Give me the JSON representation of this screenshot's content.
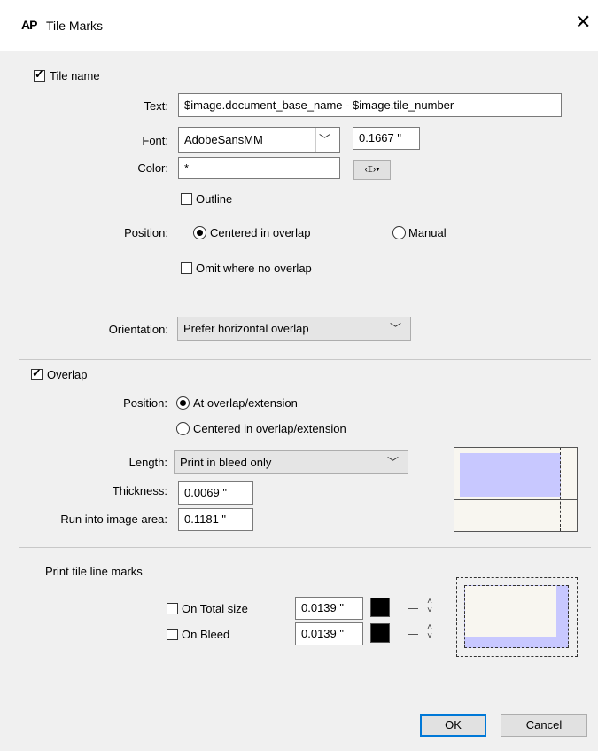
{
  "window": {
    "app_icon": "AP",
    "title": "Tile Marks",
    "close_glyph": "✕"
  },
  "tile_name": {
    "checkbox_label": "Tile name",
    "text_label": "Text:",
    "text_value": "$image.document_base_name - $image.tile_number",
    "font_label": "Font:",
    "font_value": "AdobeSansMM",
    "font_size": "0.1667 \"",
    "color_label": "Color:",
    "color_value": "*",
    "color_button_glyph": "‹⌶›▾",
    "outline_label": "Outline",
    "position_label": "Position:",
    "position_centered": "Centered in overlap",
    "position_manual": "Manual",
    "omit_label": "Omit where no overlap",
    "orientation_label": "Orientation:",
    "orientation_value": "Prefer horizontal overlap"
  },
  "overlap": {
    "checkbox_label": "Overlap",
    "position_label": "Position:",
    "position_at": "At overlap/extension",
    "position_centered": "Centered in overlap/extension",
    "length_label": "Length:",
    "length_value": "Print in bleed only",
    "thickness_label": "Thickness:",
    "thickness_value": "0.0069 \"",
    "run_into_label": "Run into image area:",
    "run_into_value": "0.1181 \""
  },
  "tile_line_marks": {
    "section_label": "Print tile line marks",
    "total_size_label": "On Total size",
    "total_size_value": "0.0139 \"",
    "bleed_label": "On Bleed",
    "bleed_value": "0.0139 \""
  },
  "buttons": {
    "ok": "OK",
    "cancel": "Cancel"
  },
  "colors": {
    "accent": "#0078d7",
    "preview_fill": "#c8c8ff",
    "preview_bg": "#f8f6f0"
  },
  "icons": {
    "chevron": "chevron-down-icon",
    "up_down": "up-down-arrows-icon"
  }
}
